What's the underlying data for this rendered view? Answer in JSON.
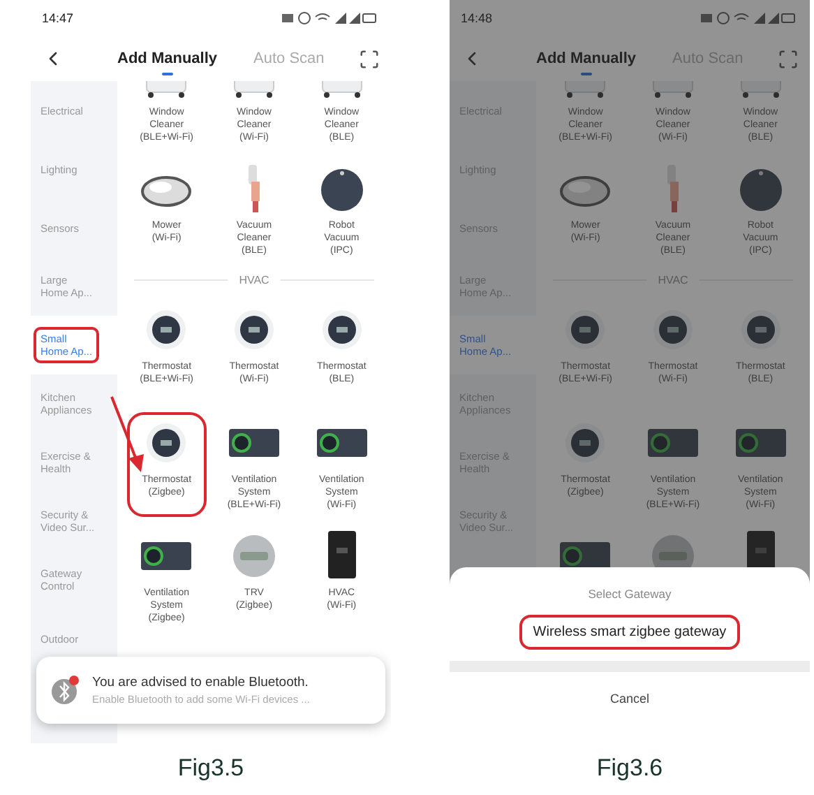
{
  "figures": [
    {
      "caption": "Fig3.5",
      "dimmed": false,
      "status_time": "14:47",
      "tabs": [
        {
          "label": "Add Manually",
          "selected": true
        },
        {
          "label": "Auto Scan",
          "selected": false
        }
      ],
      "categories": [
        {
          "label": "Electrical",
          "selected": false,
          "highlighted": false
        },
        {
          "label": "Lighting",
          "selected": false,
          "highlighted": false
        },
        {
          "label": "Sensors",
          "selected": false,
          "highlighted": false
        },
        {
          "label": "Large\nHome Ap...",
          "selected": false,
          "highlighted": false
        },
        {
          "label": "Small\nHome Ap...",
          "selected": true,
          "highlighted": true
        },
        {
          "label": "Kitchen\nAppliances",
          "selected": false,
          "highlighted": false
        },
        {
          "label": "Exercise &\nHealth",
          "selected": false,
          "highlighted": false
        },
        {
          "label": "Security &\nVideo Sur...",
          "selected": false,
          "highlighted": false
        },
        {
          "label": "Gateway\nControl",
          "selected": false,
          "highlighted": false
        },
        {
          "label": "Outdoor",
          "selected": false,
          "highlighted": false
        }
      ],
      "rows": [
        {
          "kind": "devices",
          "items": [
            {
              "kind": "window",
              "label": "Window\nCleaner\n(BLE+Wi-Fi)",
              "highlighted": false
            },
            {
              "kind": "window",
              "label": "Window\nCleaner\n(Wi-Fi)",
              "highlighted": false
            },
            {
              "kind": "window",
              "label": "Window\nCleaner\n(BLE)",
              "highlighted": false
            }
          ]
        },
        {
          "kind": "devices",
          "items": [
            {
              "kind": "mower",
              "label": "Mower\n(Wi-Fi)",
              "highlighted": false
            },
            {
              "kind": "stick",
              "label": "Vacuum\nCleaner\n(BLE)",
              "highlighted": false
            },
            {
              "kind": "robot",
              "label": "Robot\nVacuum\n(IPC)",
              "highlighted": false
            }
          ]
        },
        {
          "kind": "heading",
          "label": "HVAC"
        },
        {
          "kind": "devices",
          "items": [
            {
              "kind": "thermostat",
              "label": "Thermostat\n(BLE+Wi-Fi)",
              "highlighted": false
            },
            {
              "kind": "thermostat",
              "label": "Thermostat\n(Wi-Fi)",
              "highlighted": false
            },
            {
              "kind": "thermostat",
              "label": "Thermostat\n(BLE)",
              "highlighted": false
            }
          ]
        },
        {
          "kind": "devices",
          "items": [
            {
              "kind": "thermostat",
              "label": "Thermostat\n(Zigbee)",
              "highlighted": true
            },
            {
              "kind": "vent",
              "label": "Ventilation\nSystem\n(BLE+Wi-Fi)",
              "highlighted": false
            },
            {
              "kind": "vent",
              "label": "Ventilation\nSystem\n(Wi-Fi)",
              "highlighted": false
            }
          ]
        },
        {
          "kind": "devices",
          "items": [
            {
              "kind": "vent",
              "label": "Ventilation\nSystem\n(Zigbee)",
              "highlighted": false
            },
            {
              "kind": "trv",
              "label": "TRV\n(Zigbee)",
              "highlighted": false
            },
            {
              "kind": "hvac",
              "label": "HVAC\n(Wi-Fi)",
              "highlighted": false
            }
          ]
        }
      ],
      "toast": {
        "title": "You are advised to enable Bluetooth.",
        "text": "Enable Bluetooth to add some Wi-Fi devices ..."
      }
    },
    {
      "caption": "Fig3.6",
      "dimmed": true,
      "status_time": "14:48",
      "tabs": [
        {
          "label": "Add Manually",
          "selected": true
        },
        {
          "label": "Auto Scan",
          "selected": false
        }
      ],
      "categories": [
        {
          "label": "Electrical",
          "selected": false,
          "highlighted": false
        },
        {
          "label": "Lighting",
          "selected": false,
          "highlighted": false
        },
        {
          "label": "Sensors",
          "selected": false,
          "highlighted": false
        },
        {
          "label": "Large\nHome Ap...",
          "selected": false,
          "highlighted": false
        },
        {
          "label": "Small\nHome Ap...",
          "selected": true,
          "highlighted": false
        },
        {
          "label": "Kitchen\nAppliances",
          "selected": false,
          "highlighted": false
        },
        {
          "label": "Exercise &\nHealth",
          "selected": false,
          "highlighted": false
        },
        {
          "label": "Security &\nVideo Sur...",
          "selected": false,
          "highlighted": false
        }
      ],
      "rows": [
        {
          "kind": "devices",
          "items": [
            {
              "kind": "window",
              "label": "Window\nCleaner\n(BLE+Wi-Fi)",
              "highlighted": false
            },
            {
              "kind": "window",
              "label": "Window\nCleaner\n(Wi-Fi)",
              "highlighted": false
            },
            {
              "kind": "window",
              "label": "Window\nCleaner\n(BLE)",
              "highlighted": false
            }
          ]
        },
        {
          "kind": "devices",
          "items": [
            {
              "kind": "mower",
              "label": "Mower\n(Wi-Fi)",
              "highlighted": false
            },
            {
              "kind": "stick",
              "label": "Vacuum\nCleaner\n(BLE)",
              "highlighted": false
            },
            {
              "kind": "robot",
              "label": "Robot\nVacuum\n(IPC)",
              "highlighted": false
            }
          ]
        },
        {
          "kind": "heading",
          "label": "HVAC"
        },
        {
          "kind": "devices",
          "items": [
            {
              "kind": "thermostat",
              "label": "Thermostat\n(BLE+Wi-Fi)",
              "highlighted": false
            },
            {
              "kind": "thermostat",
              "label": "Thermostat\n(Wi-Fi)",
              "highlighted": false
            },
            {
              "kind": "thermostat",
              "label": "Thermostat\n(BLE)",
              "highlighted": false
            }
          ]
        },
        {
          "kind": "devices",
          "items": [
            {
              "kind": "thermostat",
              "label": "Thermostat\n(Zigbee)",
              "highlighted": false
            },
            {
              "kind": "vent",
              "label": "Ventilation\nSystem\n(BLE+Wi-Fi)",
              "highlighted": false
            },
            {
              "kind": "vent",
              "label": "Ventilation\nSystem\n(Wi-Fi)",
              "highlighted": false
            }
          ]
        },
        {
          "kind": "devices",
          "items": [
            {
              "kind": "vent"
            },
            {
              "kind": "trv"
            },
            {
              "kind": "hvac"
            }
          ]
        }
      ],
      "sheet": {
        "title": "Select Gateway",
        "options": [
          {
            "label": "Wireless smart zigbee gateway",
            "highlighted": true
          }
        ],
        "cancel": "Cancel"
      }
    }
  ]
}
